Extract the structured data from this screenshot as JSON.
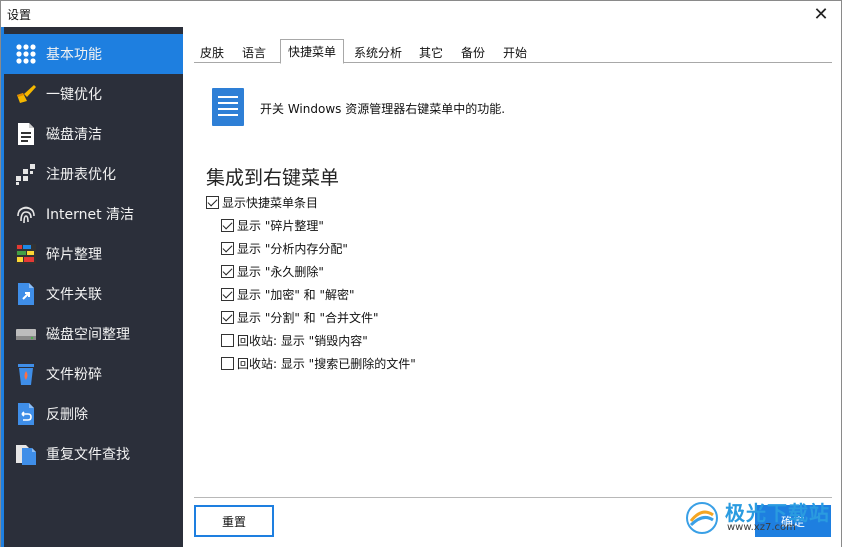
{
  "window": {
    "title": "设置",
    "close_glyph": "✕"
  },
  "sidebar": {
    "items": [
      {
        "label": "基本功能",
        "icon": "grid-dots-icon",
        "active": true
      },
      {
        "label": "一键优化",
        "icon": "broom-icon"
      },
      {
        "label": "磁盘清洁",
        "icon": "binary-file-icon"
      },
      {
        "label": "注册表优化",
        "icon": "registry-cubes-icon"
      },
      {
        "label": "Internet 清洁",
        "icon": "fingerprint-icon"
      },
      {
        "label": "碎片整理",
        "icon": "defrag-bars-icon"
      },
      {
        "label": "文件关联",
        "icon": "file-link-icon"
      },
      {
        "label": "磁盘空间整理",
        "icon": "hard-drive-icon"
      },
      {
        "label": "文件粉碎",
        "icon": "shredder-bin-icon"
      },
      {
        "label": "反删除",
        "icon": "undelete-icon"
      },
      {
        "label": "重复文件查找",
        "icon": "duplicate-files-icon"
      }
    ]
  },
  "tabs": [
    {
      "label": "皮肤"
    },
    {
      "label": "语言"
    },
    {
      "label": "快捷菜单",
      "active": true
    },
    {
      "label": "系统分析"
    },
    {
      "label": "其它"
    },
    {
      "label": "备份"
    },
    {
      "label": "开始"
    }
  ],
  "main": {
    "info_text": "开关 Windows 资源管理器右键菜单中的功能.",
    "info_icon": "document-lines-icon",
    "section_title": "集成到右键菜单",
    "options": [
      {
        "label": "显示快捷菜单条目",
        "checked": true
      },
      {
        "label": "显示 \"碎片整理\"",
        "checked": true
      },
      {
        "label": "显示 \"分析内存分配\"",
        "checked": true
      },
      {
        "label": "显示 \"永久删除\"",
        "checked": true
      },
      {
        "label": "显示 \"加密\" 和 \"解密\"",
        "checked": true
      },
      {
        "label": "显示 \"分割\" 和 \"合并文件\"",
        "checked": true
      },
      {
        "label": "回收站: 显示 \"销毁内容\"",
        "checked": false
      },
      {
        "label": "回收站: 显示 \"搜索已删除的文件\"",
        "checked": false
      }
    ]
  },
  "footer": {
    "reset_label": "重置",
    "ok_label": "确定"
  },
  "watermark": {
    "text": "极光下载站",
    "url": "www.xz7.com"
  },
  "colors": {
    "accent": "#1e7fe0",
    "sidebar_bg": "#2b2f3a",
    "sidebar_text": "#f2f2f2"
  }
}
